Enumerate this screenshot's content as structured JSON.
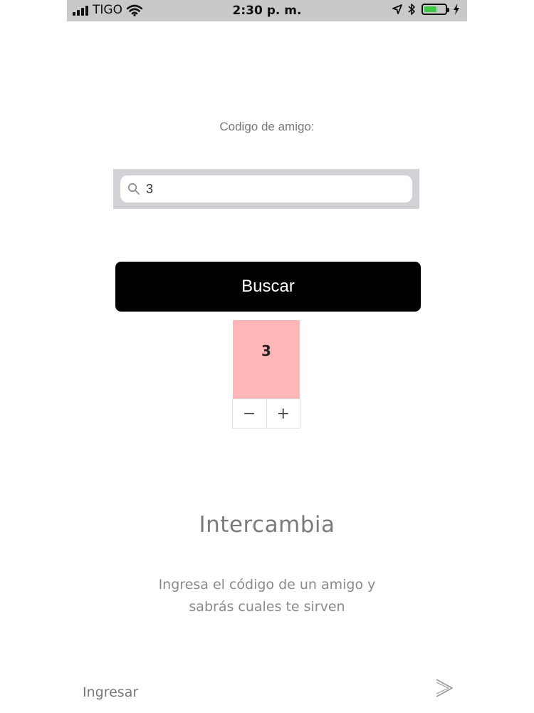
{
  "status_bar": {
    "carrier": "TIGO",
    "time": "2:30 p. m.",
    "battery_color": "#3ec84a",
    "battery_level": 0.62,
    "icons": [
      "signal-icon",
      "wifi-icon",
      "location-arrow-icon",
      "bluetooth-icon",
      "battery-icon",
      "charging-bolt-icon"
    ]
  },
  "search": {
    "label": "Codigo de amigo:",
    "value": "3",
    "button_label": "Buscar"
  },
  "result": {
    "value": "3",
    "cell_color": "#ffb6b9",
    "decrement_label": "−",
    "increment_label": "+"
  },
  "info": {
    "title": "Intercambia",
    "subtitle_line1": "Ingresa el código de un amigo y",
    "subtitle_line2": "sabrás cuales te sirven"
  },
  "footer": {
    "login_label": "Ingresar",
    "next_icon": "chevron-right-icon"
  }
}
